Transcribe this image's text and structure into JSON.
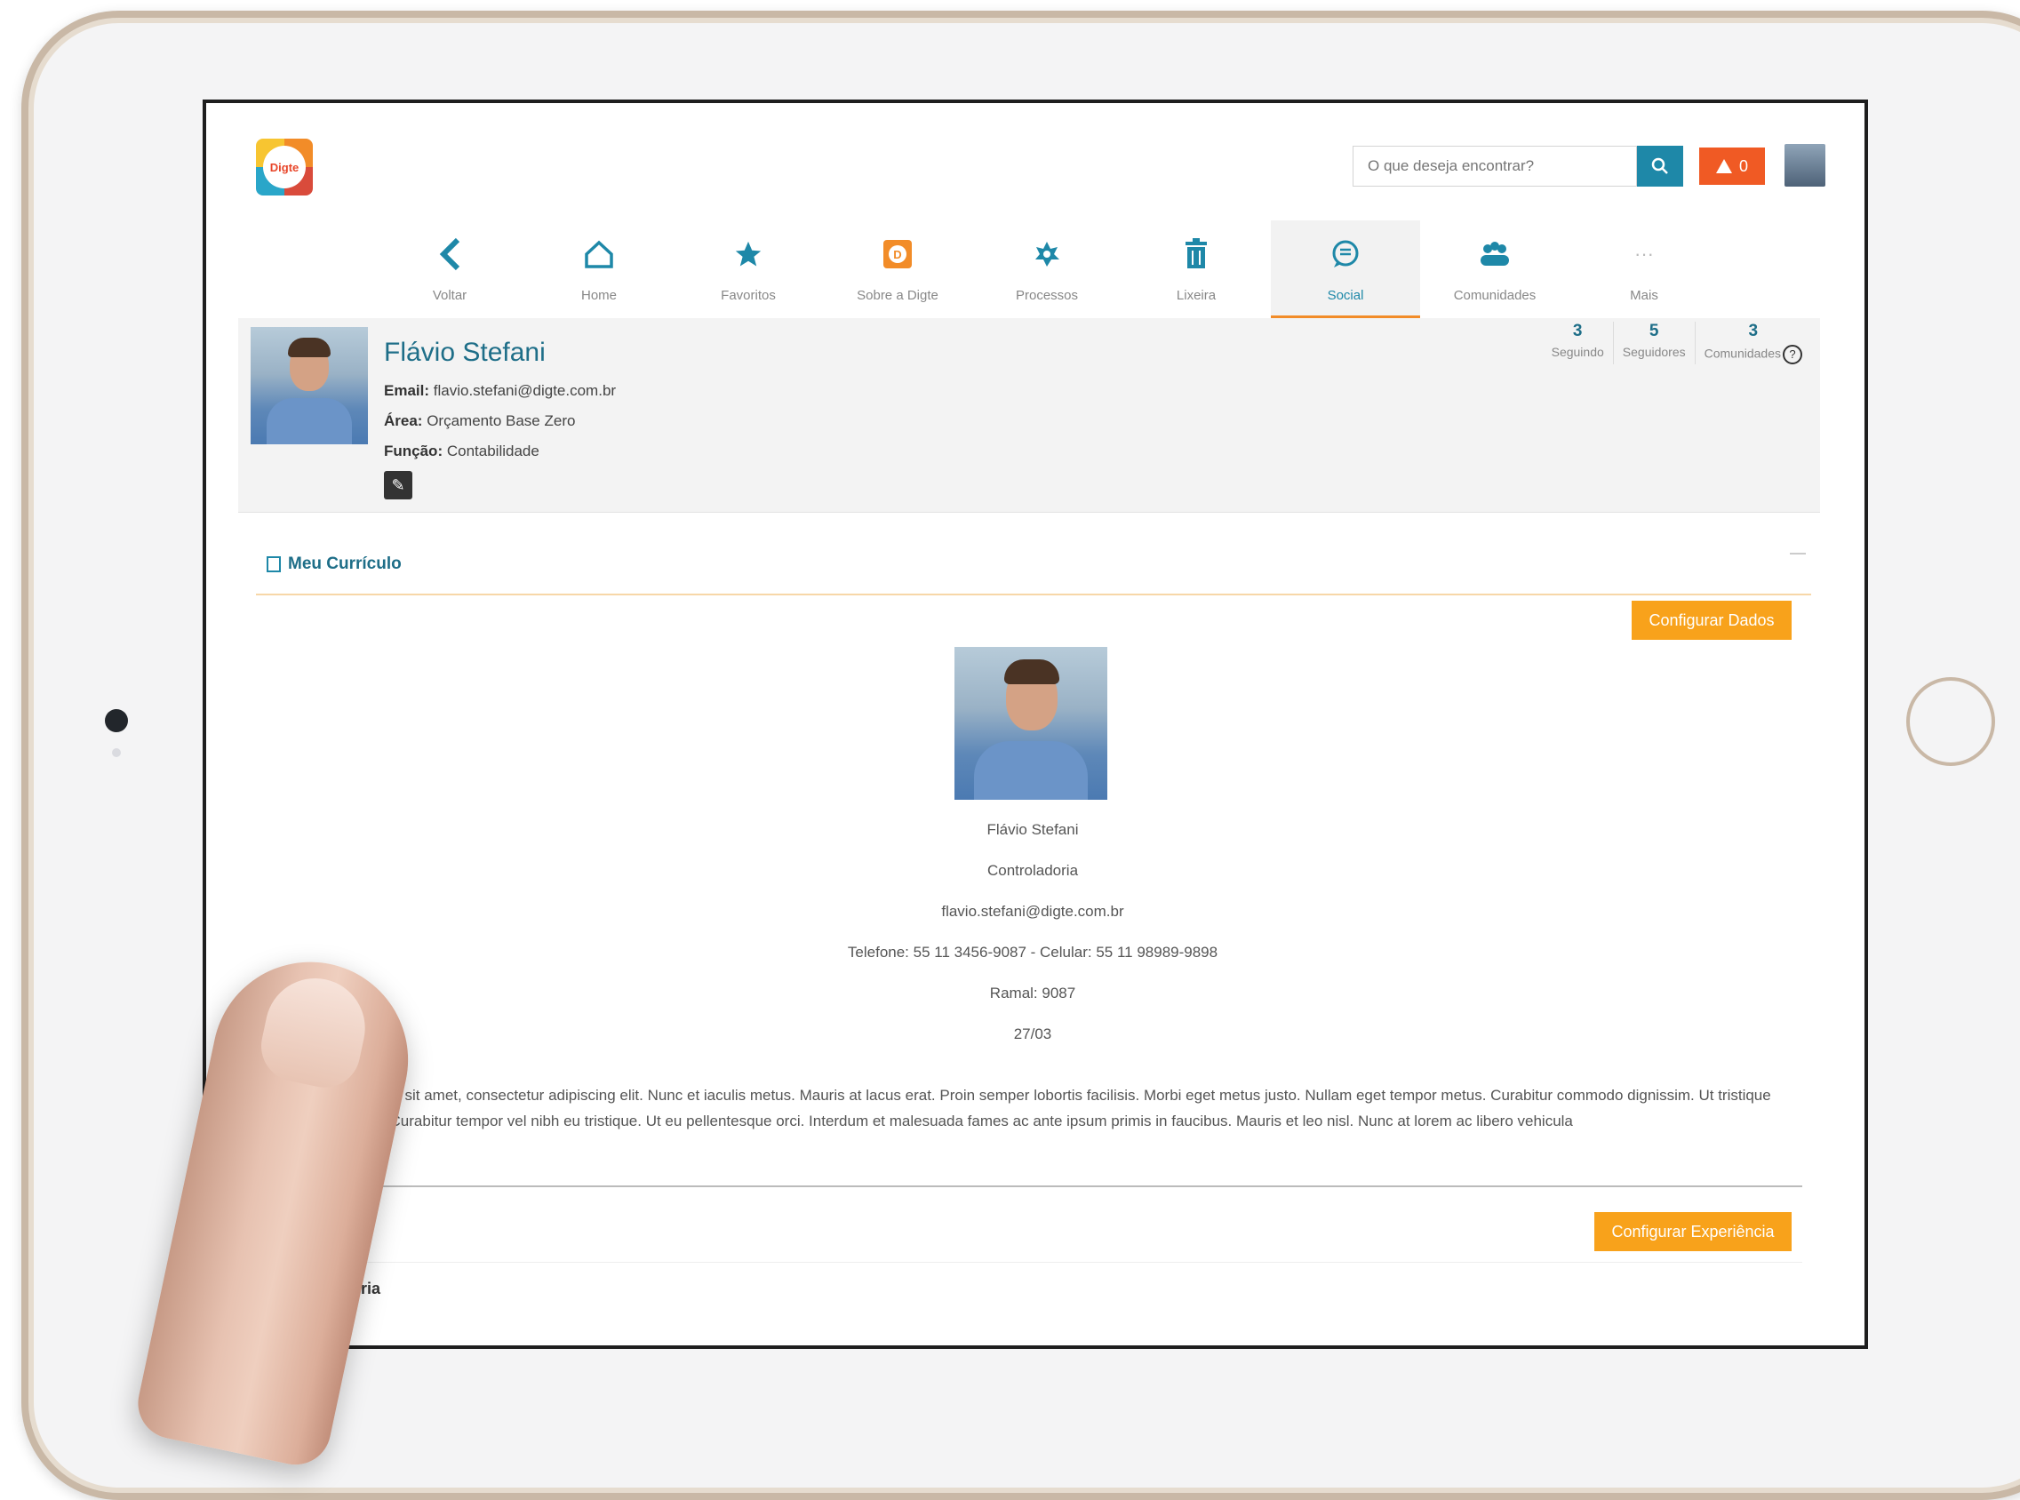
{
  "header": {
    "logo_text": "Digte",
    "search_placeholder": "O que deseja encontrar?",
    "alert_count": "0"
  },
  "nav": {
    "items": [
      {
        "label": "Voltar",
        "icon": "chevron-left-icon"
      },
      {
        "label": "Home",
        "icon": "home-icon"
      },
      {
        "label": "Favoritos",
        "icon": "star-icon"
      },
      {
        "label": "Sobre a Digte",
        "icon": "digte-badge-icon"
      },
      {
        "label": "Processos",
        "icon": "processes-icon"
      },
      {
        "label": "Lixeira",
        "icon": "trash-icon"
      },
      {
        "label": "Social",
        "icon": "chat-icon"
      },
      {
        "label": "Comunidades",
        "icon": "community-icon"
      },
      {
        "label": "Mais",
        "icon": "more-icon"
      }
    ],
    "active": "Social"
  },
  "profile": {
    "name": "Flávio Stefani",
    "email_label": "Email:",
    "email": "flavio.stefani@digte.com.br",
    "area_label": "Área:",
    "area": "Orçamento Base Zero",
    "funcao_label": "Função:",
    "funcao": "Contabilidade",
    "stats": [
      {
        "count": "3",
        "label": "Seguindo"
      },
      {
        "count": "5",
        "label": "Seguidores"
      },
      {
        "count": "3",
        "label": "Comunidades"
      }
    ]
  },
  "curriculum": {
    "title": "Meu Currículo",
    "configure_data_button": "Configurar Dados",
    "name": "Flávio Stefani",
    "department": "Controladoria",
    "email": "flavio.stefani@digte.com.br",
    "phone_line": "Telefone: 55 11 3456-9087 - Celular: 55 11 98989-9898",
    "extension_line": "Ramal: 9087",
    "date": "27/03",
    "paragraph": "Lorem ipsum dolor sit amet, consectetur adipiscing elit. Nunc et iaculis metus. Mauris at lacus erat. Proin semper lobortis facilisis. Morbi eget metus justo. Nullam eget tempor metus. Curabitur commodo dignissim. Ut tristique tellus gravida at. Curabitur tempor vel nibh eu tristique. Ut eu pellentesque orci. Interdum et malesuada fames ac ante ipsum primis in faucibus. Mauris et leo nisl. Nunc at lorem ac libero vehicula",
    "configure_experience_button": "Configurar Experiência",
    "experience_item": "Controladoria"
  },
  "colors": {
    "accent": "#1e88a8",
    "orange": "#f8a21b",
    "alert": "#f05a24",
    "active_tab_border": "#f28c28"
  }
}
